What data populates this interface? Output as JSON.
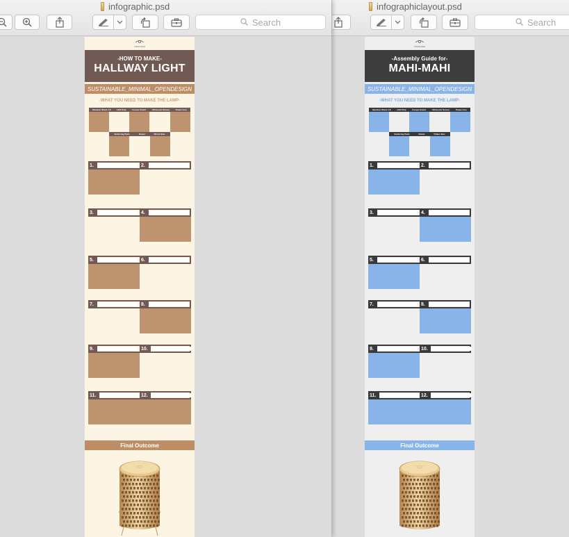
{
  "windows": [
    {
      "title": "infographic.psd",
      "search": {
        "placeholder": "Search"
      },
      "doc": {
        "theme": {
          "page": "#fdf5e4",
          "hero": "#725a54",
          "accent": "#bd8e66",
          "box": "#bd946f",
          "dark": "#725a54",
          "need_text": "#c9a17c"
        },
        "logo_text": "KAHI-HAHI",
        "hero_small": "-HOW TO MAKE-",
        "hero_big": "HALLWAY LIGHT",
        "subtitle": "SUSTAINABLE_MINIMAL_OPENDESIGN",
        "need": "-WHAT YOU NEED TO MAKE THE LAMP-",
        "materials_top": [
          "Bamboo Sheet 1:8",
          "LED Strip",
          "Cooper Board",
          "Ultrasonic Sensor",
          "Power Line"
        ],
        "materials_bottom": [
          "Soldering Parts",
          "Dowel",
          "Wood Glue"
        ],
        "steps": [
          "1.",
          "2.",
          "3.",
          "4.",
          "5.",
          "6.",
          "7.",
          "8.",
          "9.",
          "10.",
          "11.",
          "12."
        ],
        "final": "Final Outcome"
      }
    },
    {
      "title": "infographiclayout.psd",
      "search": {
        "placeholder": "Search"
      },
      "doc": {
        "theme": {
          "page": "#efefef",
          "hero": "#3d3d3d",
          "accent": "#88b4ea",
          "box": "#88b4ea",
          "dark": "#3a3a3a",
          "need_text": "#7ea8e2"
        },
        "logo_text": "KAHI-HAHI",
        "hero_small": "-Assembly Guide for-",
        "hero_big": "MAHI-MAHI",
        "subtitle": "SUSTAINABLE_MINIMAL_OPENDESIGN",
        "need": "-WHAT YOU NEED TO MAKE THE LAMP-",
        "materials_top": [
          "Bamboo Sheet 1:8",
          "LED Strip",
          "Cooper Board",
          "Ultrasonic Sensor",
          "Power Line"
        ],
        "materials_bottom": [
          "Soldering Parts",
          "Dowel",
          "Timber Box"
        ],
        "steps": [
          "1.",
          "2.",
          "3.",
          "4.",
          "5.",
          "6.",
          "7.",
          "8.",
          "9.",
          "10.",
          "11.",
          "12."
        ],
        "final": "Final Outcome"
      }
    }
  ],
  "icons": [
    "zoom-out-icon",
    "zoom-in-icon",
    "share-icon",
    "markup-pen-icon",
    "chevron-down-icon",
    "rotate-icon",
    "toolbox-icon",
    "search-icon",
    "file-icon"
  ]
}
